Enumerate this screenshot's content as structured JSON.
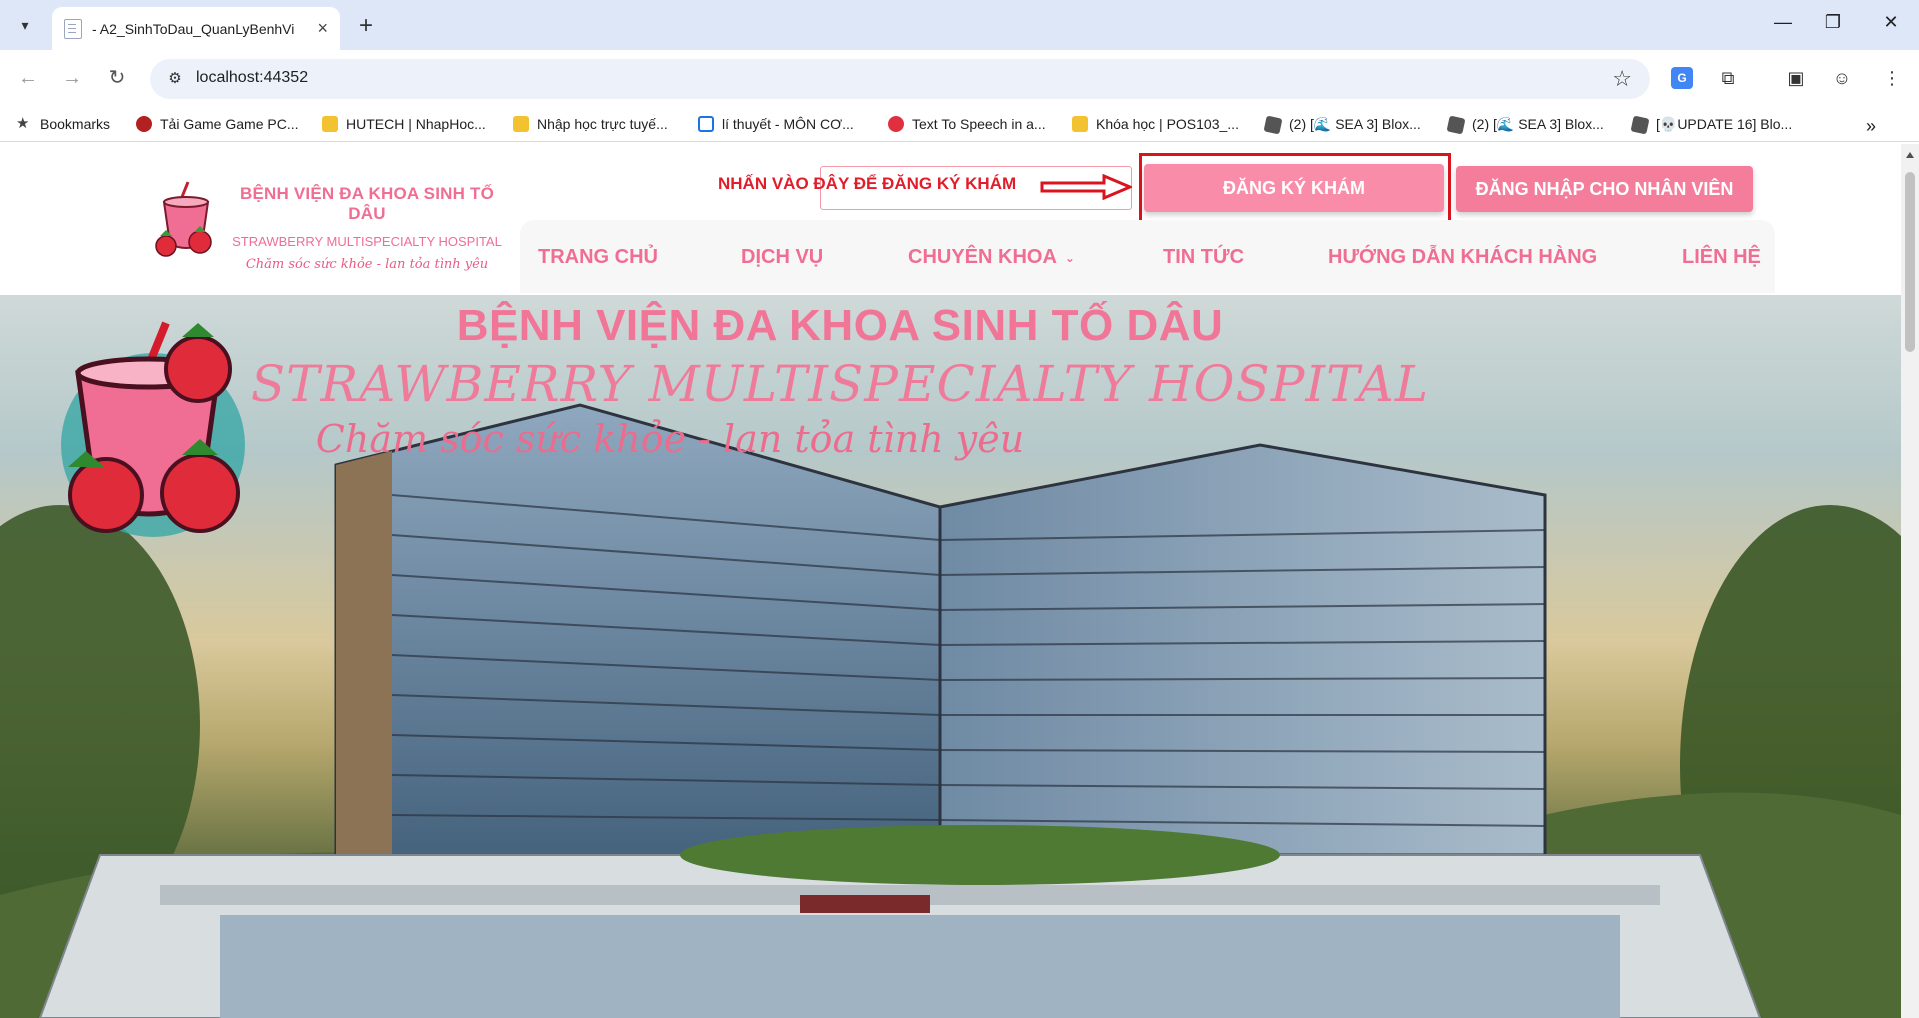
{
  "browser": {
    "tab_title": "- A2_SinhToDau_QuanLyBenhVi",
    "url": "localhost:44352",
    "bookmarks": [
      {
        "label": "Bookmarks",
        "icon": "star-icon"
      },
      {
        "label": "Tải Game Game PC...",
        "icon": "game-icon"
      },
      {
        "label": "HUTECH | NhapHoc...",
        "icon": "shield-icon"
      },
      {
        "label": "Nhập học trực tuyế...",
        "icon": "shield-icon"
      },
      {
        "label": "lí thuyết - MÔN CƠ...",
        "icon": "board-icon"
      },
      {
        "label": "Text To Speech in a...",
        "icon": "heart-icon"
      },
      {
        "label": "Khóa học | POS103_...",
        "icon": "shield-icon"
      },
      {
        "label": "(2) [🌊 SEA 3] Blox...",
        "icon": "roblox-icon"
      },
      {
        "label": "(2) [🌊 SEA 3] Blox...",
        "icon": "roblox-icon"
      },
      {
        "label": "[💀UPDATE 16] Blo...",
        "icon": "roblox-icon"
      }
    ]
  },
  "header": {
    "brand_name": "BỆNH VIỆN ĐA KHOA SINH TỐ DÂU",
    "brand_en": "STRAWBERRY MULTISPECIALTY HOSPITAL",
    "brand_slogan": "Chăm sóc sức khỏe - lan tỏa tình yêu",
    "hint": "NHẤN VÀO ĐÂY ĐỂ ĐĂNG KÝ KHÁM",
    "register_button": "ĐĂNG KÝ KHÁM",
    "staff_login_button": "ĐĂNG NHẬP CHO NHÂN VIÊN"
  },
  "nav": {
    "items": [
      "TRANG CHỦ",
      "DỊCH VỤ",
      "CHUYÊN KHOA",
      "TIN TỨC",
      "HƯỚNG DẪN KHÁCH HÀNG",
      "LIÊN HỆ"
    ]
  },
  "hero": {
    "title": "BỆNH VIỆN ĐA KHOA SINH TỐ DÂU",
    "subtitle": "STRAWBERRY MULTISPECIALTY HOSPITAL",
    "slogan": "Chăm sóc sức khỏe - lan tỏa tình yêu"
  },
  "colors": {
    "brand_pink": "#f06d94",
    "button_pink": "#f98da9",
    "highlight_red": "#d9141e"
  }
}
